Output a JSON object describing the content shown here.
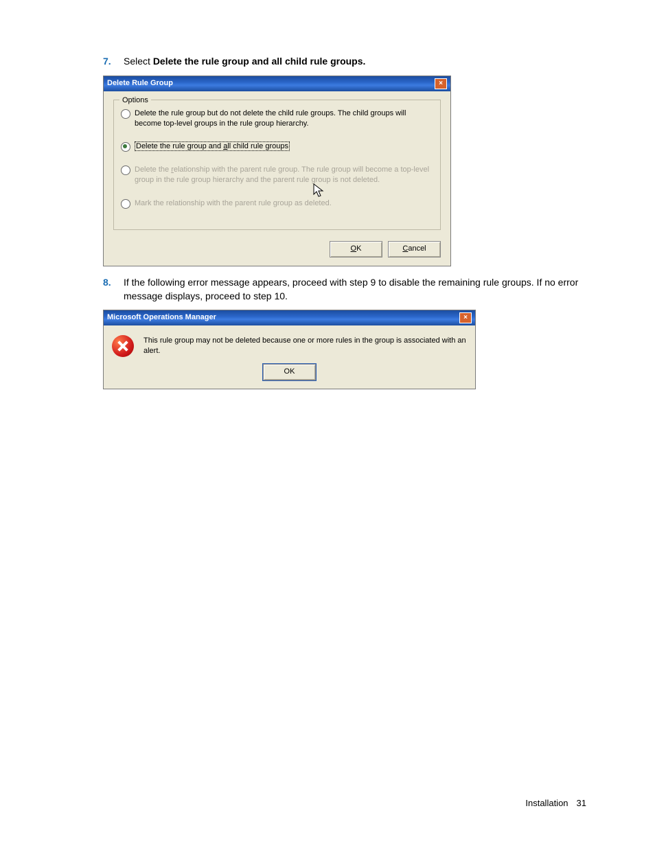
{
  "steps": {
    "n7": "7.",
    "t7_pre": "Select ",
    "t7_bold": "Delete the rule group and all child rule groups.",
    "n8": "8.",
    "t8": "If the following error message appears, proceed with step 9 to disable the remaining rule groups. If no error message displays, proceed to step 10."
  },
  "dialog1": {
    "title": "Delete Rule Group",
    "legend": "Options",
    "opt1": "Delete the rule group but do not delete the child rule groups.  The child groups will become top-level groups in the rule group hierarchy.",
    "opt2_pre": "Delete the rule group and ",
    "opt2_u": "a",
    "opt2_post": "ll child rule groups",
    "opt3_pre": "Delete the ",
    "opt3_u": "r",
    "opt3_post": "elationship with the parent rule group.  The rule group will become a top-level group in the rule group hierarchy and the parent rule group is not deleted.",
    "opt4": "Mark the relationship with the parent rule group as deleted.",
    "ok_u": "O",
    "ok_post": "K",
    "cancel_u": "C",
    "cancel_post": "ancel"
  },
  "dialog2": {
    "title": "Microsoft Operations Manager",
    "msg": "This rule group may not be deleted because one or more rules in the group is associated with an alert.",
    "ok": "OK"
  },
  "footer": {
    "section": "Installation",
    "page": "31"
  }
}
